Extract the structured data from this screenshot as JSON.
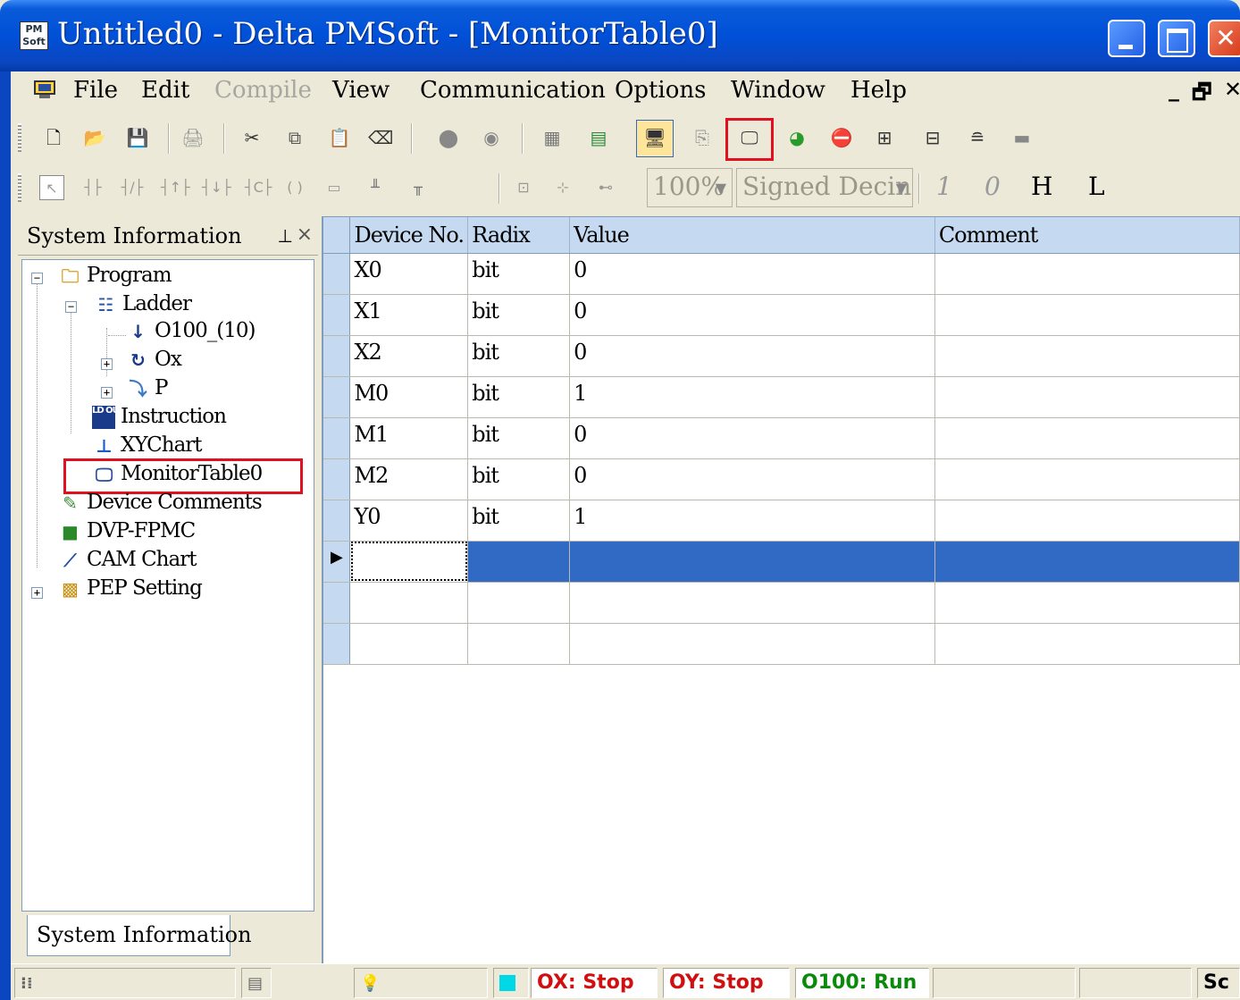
{
  "window": {
    "title": "Untitled0 - Delta PMSoft - [MonitorTable0]",
    "app_icon_text": "PM Soft"
  },
  "menubar": {
    "items": [
      "File",
      "Edit",
      "Compile",
      "View",
      "Communication",
      "Options",
      "Window",
      "Help"
    ],
    "mdi_controls": [
      "_",
      "̅□",
      "×"
    ]
  },
  "toolbar2": {
    "zoom": "100%",
    "radix": "Signed Decin",
    "buttons": [
      "1",
      "0",
      "H",
      "L"
    ]
  },
  "panel": {
    "title": "System Information",
    "tab_label": "System Information",
    "tree": {
      "program": "Program",
      "ladder": "Ladder",
      "o100": "O100_(10)",
      "ox": "Ox",
      "p": "P",
      "instruction": "Instruction",
      "xychart": "XYChart",
      "monitortable": "MonitorTable0",
      "device_comments": "Device Comments",
      "dvp_fpmc": "DVP-FPMC",
      "cam_chart": "CAM Chart",
      "pep_setting": "PEP Setting"
    }
  },
  "grid": {
    "columns": [
      "Device No.",
      "Radix",
      "Value",
      "Comment"
    ],
    "rows": [
      {
        "device": "X0",
        "radix": "bit",
        "value": "0",
        "comment": ""
      },
      {
        "device": "X1",
        "radix": "bit",
        "value": "0",
        "comment": ""
      },
      {
        "device": "X2",
        "radix": "bit",
        "value": "0",
        "comment": ""
      },
      {
        "device": "M0",
        "radix": "bit",
        "value": "1",
        "comment": ""
      },
      {
        "device": "M1",
        "radix": "bit",
        "value": "0",
        "comment": ""
      },
      {
        "device": "M2",
        "radix": "bit",
        "value": "0",
        "comment": ""
      },
      {
        "device": "Y0",
        "radix": "bit",
        "value": "1",
        "comment": ""
      }
    ]
  },
  "statusbar": {
    "ox": "OX: Stop",
    "oy": "OY: Stop",
    "o100": "O100: Run",
    "sc": "Sc"
  },
  "colors": {
    "title_blue": "#0050d8",
    "highlight_red": "#e01020",
    "grid_header": "#c5d9f1",
    "selection": "#316ac5",
    "status_red": "#d01010",
    "status_green": "#0a8a0a"
  }
}
